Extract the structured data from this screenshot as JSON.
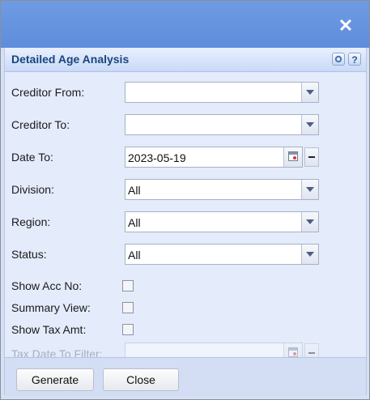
{
  "dialog": {
    "panel_title": "Detailed Age Analysis",
    "help_label": "?",
    "close_glyph": "✕"
  },
  "fields": {
    "creditor_from": {
      "label": "Creditor From:",
      "value": ""
    },
    "creditor_to": {
      "label": "Creditor To:",
      "value": ""
    },
    "date_to": {
      "label": "Date To:",
      "value": "2023-05-19"
    },
    "division": {
      "label": "Division:",
      "value": "All"
    },
    "region": {
      "label": "Region:",
      "value": "All"
    },
    "status": {
      "label": "Status:",
      "value": "All"
    },
    "show_acc_no": {
      "label": "Show Acc No:",
      "checked": false
    },
    "summary_view": {
      "label": "Summary View:",
      "checked": false
    },
    "show_tax_amt": {
      "label": "Show Tax Amt:",
      "checked": false
    },
    "tax_date_to_filter": {
      "label": "Tax Date To Filter:",
      "value": "",
      "disabled": true
    }
  },
  "buttons": {
    "generate": "Generate",
    "close": "Close"
  },
  "icons": {
    "close": "close-icon",
    "gear": "gear-icon",
    "help": "help-icon",
    "calendar": "calendar-icon",
    "dropdown": "chevron-down-icon",
    "clear": "minus-icon"
  },
  "colors": {
    "titlebar": "#6f9be3",
    "panel_title": "#18457d",
    "panel_bg": "#e4ebfb",
    "footer_bg": "#d3def4"
  }
}
